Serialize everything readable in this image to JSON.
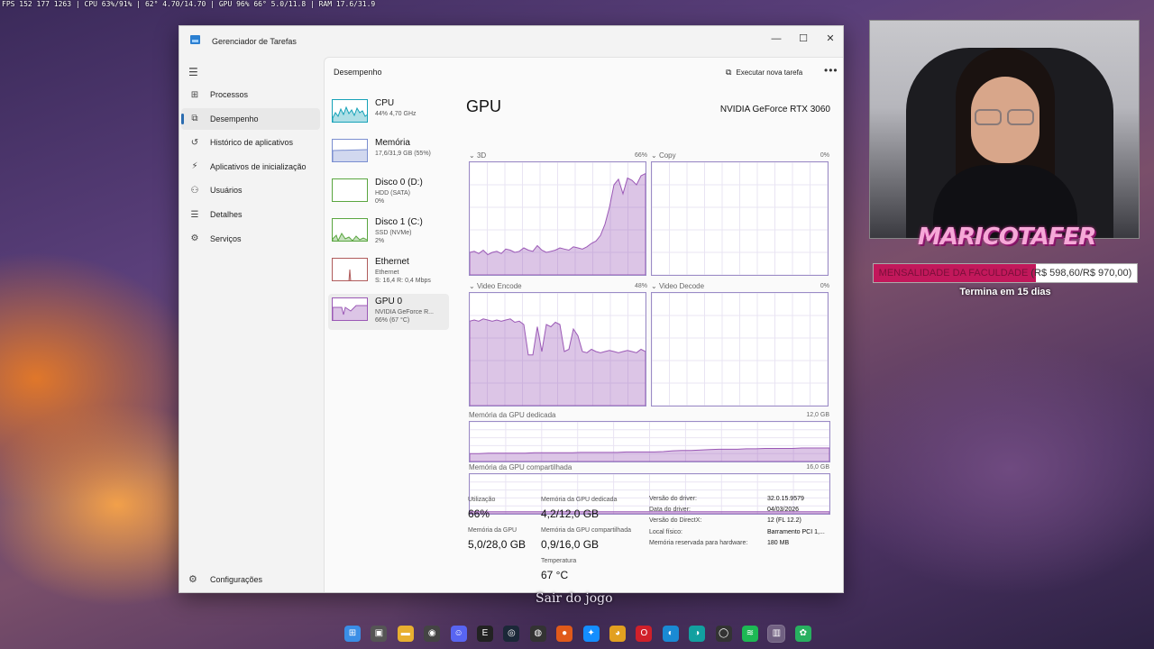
{
  "overlay": {
    "stats": "FPS 152 177 1263 | CPU 63%/91% | 62° 4.70/14.70 | GPU 96% 66° 5.0/11.8 | RAM 17.6/31.9"
  },
  "window": {
    "title": "Gerenciador de Tarefas",
    "buttons": {
      "minimize": "—",
      "maximize": "☐",
      "close": "✕"
    }
  },
  "nav": {
    "items": [
      {
        "label": "Processos",
        "icon": "apps-grid-icon",
        "glyph": "⊞",
        "active": false
      },
      {
        "label": "Desempenho",
        "icon": "performance-icon",
        "glyph": "⧉",
        "active": true
      },
      {
        "label": "Histórico de aplicativos",
        "icon": "history-icon",
        "glyph": "↺",
        "active": false
      },
      {
        "label": "Aplicativos de inicialização",
        "icon": "startup-icon",
        "glyph": "⚡",
        "active": false
      },
      {
        "label": "Usuários",
        "icon": "users-icon",
        "glyph": "⚇",
        "active": false
      },
      {
        "label": "Detalhes",
        "icon": "details-icon",
        "glyph": "☰",
        "active": false
      },
      {
        "label": "Serviços",
        "icon": "services-icon",
        "glyph": "⚙",
        "active": false
      }
    ],
    "settings_label": "Configurações"
  },
  "header": {
    "section": "Desempenho",
    "run_task": "Executar nova tarefa",
    "more": "•••"
  },
  "devices": [
    {
      "name": "CPU",
      "sub1": "44% 4,70 GHz",
      "sub2": "",
      "color": "#17a2b8",
      "active": false
    },
    {
      "name": "Memória",
      "sub1": "17,6/31,9 GB (55%)",
      "sub2": "",
      "color": "#7b8fd0",
      "active": false
    },
    {
      "name": "Disco 0 (D:)",
      "sub1": "HDD (SATA)",
      "sub2": "0%",
      "color": "#5aa640",
      "active": false
    },
    {
      "name": "Disco 1 (C:)",
      "sub1": "SSD (NVMe)",
      "sub2": "2%",
      "color": "#5aa640",
      "active": false
    },
    {
      "name": "Ethernet",
      "sub1": "Ethernet",
      "sub2": "S: 16,4 R: 0,4 Mbps",
      "color": "#b05c5c",
      "active": false
    },
    {
      "name": "GPU 0",
      "sub1": "NVIDIA GeForce R...",
      "sub2": "66% (67 °C)",
      "color": "#9b59b6",
      "active": true
    }
  ],
  "gpu": {
    "title": "GPU",
    "model": "NVIDIA GeForce RTX 3060",
    "engines": [
      {
        "label": "3D",
        "pct": "66%",
        "series": [
          20,
          21,
          19,
          22,
          18,
          20,
          21,
          19,
          23,
          22,
          20,
          21,
          24,
          22,
          21,
          26,
          22,
          20,
          21,
          22,
          24,
          23,
          22,
          25,
          24,
          23,
          25,
          28,
          30,
          35,
          45,
          60,
          80,
          85,
          72,
          86,
          84,
          80,
          88,
          90
        ]
      },
      {
        "label": "Copy",
        "pct": "0%",
        "series": []
      },
      {
        "label": "Video Encode",
        "pct": "48%",
        "series": [
          75,
          76,
          75,
          77,
          76,
          75,
          76,
          75,
          76,
          77,
          74,
          75,
          72,
          45,
          45,
          70,
          48,
          72,
          70,
          74,
          72,
          48,
          50,
          68,
          62,
          48,
          47,
          50,
          48,
          47,
          48,
          49,
          48,
          47,
          48,
          49,
          48,
          47,
          50,
          48
        ]
      },
      {
        "label": "Video Decode",
        "pct": "0%",
        "series": []
      }
    ],
    "dedicated_mem": {
      "label": "Memória da GPU dedicada",
      "max": "12,0 GB",
      "series": [
        20,
        20,
        21,
        21,
        21,
        21,
        21,
        22,
        22,
        22,
        22,
        22,
        23,
        23,
        23,
        23,
        23,
        24,
        24,
        24,
        24,
        25,
        27,
        28,
        28,
        29,
        30,
        31,
        31,
        31,
        32,
        32,
        33,
        33,
        33,
        33,
        34,
        34,
        34,
        34
      ]
    },
    "shared_mem": {
      "label": "Memória da GPU compartilhada",
      "max": "16,0 GB",
      "series": [
        5,
        5,
        5,
        5,
        5,
        5,
        5,
        5,
        5,
        5,
        5,
        5,
        5,
        5,
        5,
        5,
        5,
        5,
        5,
        5,
        5,
        5,
        5,
        5,
        5,
        5,
        5,
        5,
        5,
        5,
        5,
        5,
        5,
        5,
        5,
        5,
        5,
        5,
        5,
        5
      ]
    },
    "stats": {
      "utilization_label": "Utilização",
      "utilization": "66%",
      "dedicated_label": "Memória da GPU dedicada",
      "dedicated": "4,2/12,0 GB",
      "gpu_mem_label": "Memória da GPU",
      "gpu_mem": "5,0/28,0 GB",
      "shared_label": "Memória da GPU compartilhada",
      "shared": "0,9/16,0 GB",
      "temp_label": "Temperatura",
      "temp": "67 °C"
    },
    "info": [
      {
        "key": "Versão do driver:",
        "val": "32.0.15.9579"
      },
      {
        "key": "Data do driver:",
        "val": "04/03/2026"
      },
      {
        "key": "Versão do DirectX:",
        "val": "12 (FL 12.2)"
      },
      {
        "key": "Local físico:",
        "val": "Barramento PCI 1,..."
      },
      {
        "key": "Memória reservada para hardware:",
        "val": "180 MB"
      }
    ]
  },
  "stream": {
    "logo": "MARICOTAFER",
    "goal_name": "MENSALIDADE DA FACULDADE",
    "goal_amount": "(R$ 598,60/R$ 970,00)",
    "goal_progress": 0.617,
    "goal_sub": "Termina em 15 dias",
    "caption": "Sair do jogo"
  },
  "taskbar": {
    "icons": [
      {
        "name": "windows-start-icon",
        "glyph": "⊞",
        "color": "#3a8ee6",
        "active": false
      },
      {
        "name": "task-view-icon",
        "glyph": "▣",
        "color": "#555",
        "active": false
      },
      {
        "name": "file-explorer-icon",
        "glyph": "▬",
        "color": "#e8b030",
        "active": false
      },
      {
        "name": "app-icon",
        "glyph": "◉",
        "color": "#444",
        "active": false
      },
      {
        "name": "discord-icon",
        "glyph": "☺",
        "color": "#5865f2",
        "active": false
      },
      {
        "name": "epic-games-icon",
        "glyph": "E",
        "color": "#222",
        "active": false
      },
      {
        "name": "steam-icon",
        "glyph": "◎",
        "color": "#1b2838",
        "active": false
      },
      {
        "name": "obs-icon",
        "glyph": "◍",
        "color": "#333",
        "active": false
      },
      {
        "name": "origin-icon",
        "glyph": "●",
        "color": "#e05a1a",
        "active": false
      },
      {
        "name": "battlenet-icon",
        "glyph": "✦",
        "color": "#148eff",
        "active": false
      },
      {
        "name": "chrome-icon",
        "glyph": "◕",
        "color": "#e2a020",
        "active": false
      },
      {
        "name": "opera-icon",
        "glyph": "O",
        "color": "#d0202a",
        "active": false
      },
      {
        "name": "edge-icon",
        "glyph": "◐",
        "color": "#1a8ad4",
        "active": false
      },
      {
        "name": "app-icon-2",
        "glyph": "◑",
        "color": "#12a0a0",
        "active": false
      },
      {
        "name": "github-icon",
        "glyph": "◯",
        "color": "#333",
        "active": false
      },
      {
        "name": "spotify-icon",
        "glyph": "≋",
        "color": "#1db954",
        "active": false
      },
      {
        "name": "task-manager-icon",
        "glyph": "▥",
        "color": "#2b7fd1",
        "active": true
      },
      {
        "name": "app-icon-3",
        "glyph": "✿",
        "color": "#28b060",
        "active": false
      }
    ]
  }
}
